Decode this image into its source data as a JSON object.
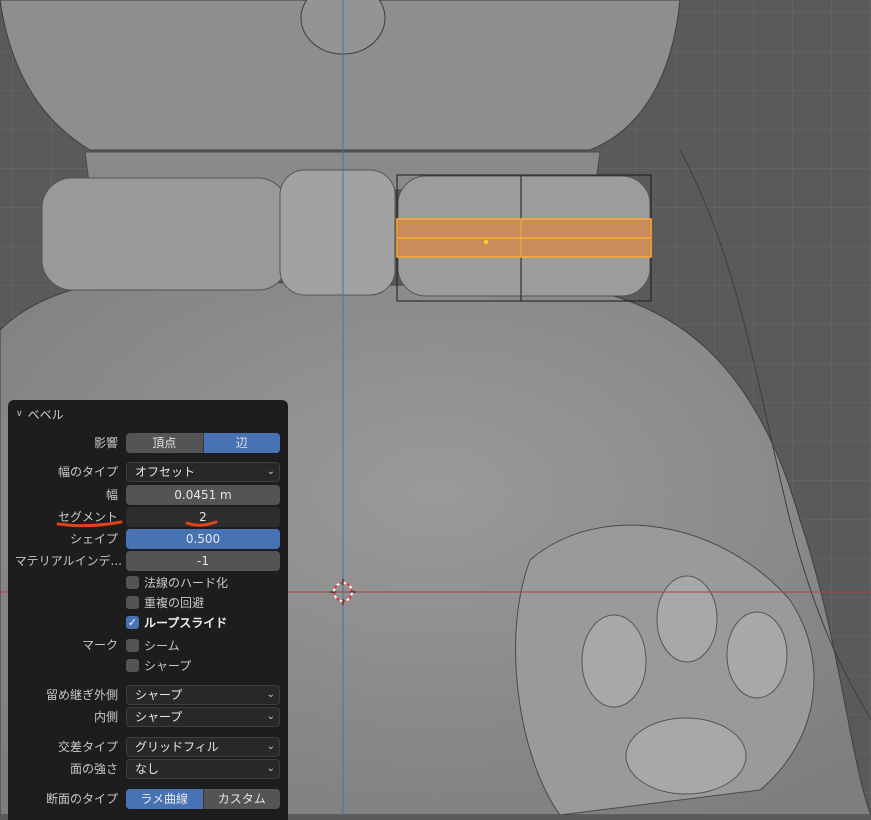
{
  "panel": {
    "title": "ベベル",
    "affect": {
      "label": "影響",
      "options": [
        "頂点",
        "辺"
      ],
      "selected": 1
    },
    "width_type": {
      "label": "幅のタイプ",
      "value": "オフセット"
    },
    "width": {
      "label": "幅",
      "value": "0.0451 m"
    },
    "segments": {
      "label": "セグメント",
      "value": "2"
    },
    "shape": {
      "label": "シェイプ",
      "value": "0.500"
    },
    "material_index": {
      "label": "マテリアルインデ...",
      "value": "-1"
    },
    "harden_normals": {
      "label": "法線のハード化",
      "checked": false
    },
    "clamp_overlap": {
      "label": "重複の回避",
      "checked": false
    },
    "loop_slide": {
      "label": "ループスライド",
      "checked": true
    },
    "mark": {
      "label": "マーク",
      "seam": {
        "label": "シーム",
        "checked": false
      },
      "sharp": {
        "label": "シャープ",
        "checked": false
      }
    },
    "miter_outer": {
      "label": "留め継ぎ外側",
      "value": "シャープ"
    },
    "miter_inner": {
      "label": "内側",
      "value": "シャープ"
    },
    "intersection_type": {
      "label": "交差タイプ",
      "value": "グリッドフィル"
    },
    "face_strength": {
      "label": "面の強さ",
      "value": "なし"
    },
    "profile_type": {
      "label": "断面のタイプ",
      "options": [
        "ラメ曲線",
        "カスタム"
      ],
      "selected": 0
    }
  },
  "colors": {
    "accent": "#4772b3",
    "selection": "#ffaa33",
    "annotation": "#e0441a",
    "viewport_bg": "#5a5a5a"
  }
}
